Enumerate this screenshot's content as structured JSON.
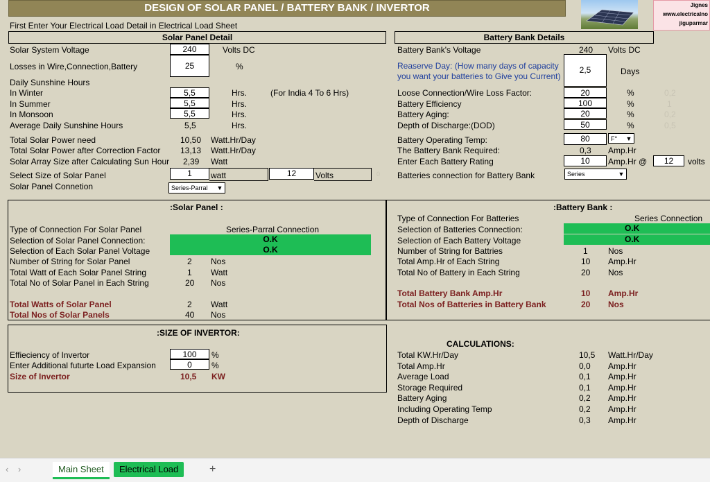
{
  "banner": "DESIGN OF SOLAR PANEL / BATTERY BANK / INVERTOR",
  "author": {
    "line1": "Jignes",
    "line2": "www.electricalno",
    "line3": "jiguparmar"
  },
  "instruction": "First Enter Your Electrical Load Detail in Electrical Load Sheet",
  "solar": {
    "header": "Solar Panel Detail",
    "system_voltage": {
      "label": "Solar System Voltage",
      "value": "240",
      "unit": "Volts DC"
    },
    "losses": {
      "label": "Losses in Wire,Connection,Battery",
      "value": "25",
      "unit": "%"
    },
    "sunshine_header": "Daily Sunshine Hours",
    "winter": {
      "label": "In Winter",
      "value": "5,5",
      "unit": "Hrs.",
      "note": "(For India 4 To 6 Hrs)"
    },
    "summer": {
      "label": "In Summer",
      "value": "5,5",
      "unit": "Hrs."
    },
    "monsoon": {
      "label": "In Monsoon",
      "value": "5,5",
      "unit": "Hrs."
    },
    "avg": {
      "label": "Average Daily Sunshine Hours",
      "value": "5,5",
      "unit": "Hrs."
    },
    "power_need": {
      "label": "Total Solar Power need",
      "value": "10,50",
      "unit": "Watt.Hr/Day"
    },
    "power_corr": {
      "label": "Total Solar Power after Correction Factor",
      "value": "13,13",
      "unit": "Watt.Hr/Day"
    },
    "array_size": {
      "label": "Solar Array Size after Calculating Sun Hour",
      "value": "2,39",
      "unit": "Watt"
    },
    "panel_size": {
      "label": "Select Size of Solar Panel",
      "watt": "1",
      "watt_unit": "watt",
      "volts": "12",
      "volts_unit": "Volts",
      "trail": "0"
    },
    "connection": {
      "label": "Solar Panel Connetion",
      "value": "Series-Parral"
    }
  },
  "battery": {
    "header": "Battery Bank Details",
    "voltage": {
      "label": "Battery Bank's Voltage",
      "value": "240",
      "unit": "Volts DC"
    },
    "reserve_line1": "Reaserve Day: (How many days of capacity",
    "reserve_line2": "you want your batteries to Give you Current)",
    "reserve_value": "2,5",
    "reserve_unit": "Days",
    "loose": {
      "label": "Loose Connection/Wire Loss Factor:",
      "value": "20",
      "unit": "%",
      "ghost": "0,2"
    },
    "efficiency": {
      "label": "Battery Efficiency",
      "value": "100",
      "unit": "%",
      "ghost": "1"
    },
    "aging": {
      "label": "Battery Aging:",
      "value": "20",
      "unit": "%",
      "ghost": "0,2"
    },
    "dod": {
      "label": "Depth of Discharge:(DOD)",
      "value": "50",
      "unit": "%",
      "ghost": "0,5"
    },
    "temp": {
      "label": "Battery Operating Temp:",
      "value": "80",
      "unit": "F°"
    },
    "required": {
      "label": "The Battery Bank Required:",
      "value": "0,3",
      "unit": "Amp.Hr"
    },
    "rating": {
      "label": "Enter Each Battery Rating",
      "value": "10",
      "unit": "Amp.Hr @",
      "volts": "12",
      "volts_unit": "volts"
    },
    "connection": {
      "label": "Batteries connection for Battery Bank",
      "value": "Series"
    }
  },
  "solar_result": {
    "title": ":Solar Panel :",
    "type": {
      "label": "Type of Connection For Solar Panel",
      "value": "Series-Parral Connection"
    },
    "sel_conn": {
      "label": "Selection of Solar Panel Connection:",
      "value": "O.K"
    },
    "sel_volt": {
      "label": "Selection of Each Solar Panel Voltage",
      "value": "O.K"
    },
    "strings": {
      "label": "Number of String for Solar Panel",
      "value": "2",
      "unit": "Nos"
    },
    "watt_string": {
      "label": "Total Watt of Each Solar Panel String",
      "value": "1",
      "unit": "Watt"
    },
    "panels_string": {
      "label": "Total No of Solar Panel in Each String",
      "value": "20",
      "unit": "Nos"
    },
    "total_watts": {
      "label": "Total Watts of Solar Panel",
      "value": "2",
      "unit": "Watt"
    },
    "total_nos": {
      "label": "Total Nos of Solar Panels",
      "value": "40",
      "unit": "Nos"
    }
  },
  "battery_result": {
    "title": ":Battery Bank :",
    "type": {
      "label": "Type of Connection For Batteries",
      "value": "Series Connection"
    },
    "sel_conn": {
      "label": "Selection of Batteries Connection:",
      "value": "O.K"
    },
    "sel_volt": {
      "label": "Selection of Each Battery Voltage",
      "value": "O.K"
    },
    "strings": {
      "label": "Number of String for Battries",
      "value": "1",
      "unit": "Nos"
    },
    "amp_string": {
      "label": "Total Amp.Hr of Each String",
      "value": "10",
      "unit": "Amp.Hr"
    },
    "nos_string": {
      "label": "Total No of Battery in Each String",
      "value": "20",
      "unit": "Nos"
    },
    "total_amp": {
      "label": "Total Battery Bank Amp.Hr",
      "value": "10",
      "unit": "Amp.Hr"
    },
    "total_nos": {
      "label": "Total Nos of Batteries in Battery Bank",
      "value": "20",
      "unit": "Nos"
    }
  },
  "invertor": {
    "title": ":SIZE OF INVERTOR:",
    "eff": {
      "label": "Effieciency of Invertor",
      "value": "100",
      "unit": "%"
    },
    "expansion": {
      "label": "Enter Additional futurte Load Expansion",
      "value": "0",
      "unit": "%"
    },
    "size": {
      "label": "Size of Invertor",
      "value": "10,5",
      "unit": "KW"
    }
  },
  "calc": {
    "title": "CALCULATIONS:",
    "rows": [
      {
        "label": "Total KW.Hr/Day",
        "value": "10,5",
        "unit": "Watt.Hr/Day"
      },
      {
        "label": "Total Amp.Hr",
        "value": "0,0",
        "unit": "Amp.Hr"
      },
      {
        "label": "Average Load",
        "value": "0,1",
        "unit": "Amp.Hr"
      },
      {
        "label": "Storage Required",
        "value": "0,1",
        "unit": "Amp.Hr"
      },
      {
        "label": "Battery Aging",
        "value": "0,2",
        "unit": "Amp.Hr"
      },
      {
        "label": "Including Operating Temp",
        "value": "0,2",
        "unit": "Amp.Hr"
      },
      {
        "label": "Depth of Discharge",
        "value": "0,3",
        "unit": "Amp.Hr"
      }
    ]
  },
  "tabs": {
    "prev": "‹",
    "next": "›",
    "main": "Main Sheet",
    "load": "Electrical Load",
    "add": "+"
  }
}
